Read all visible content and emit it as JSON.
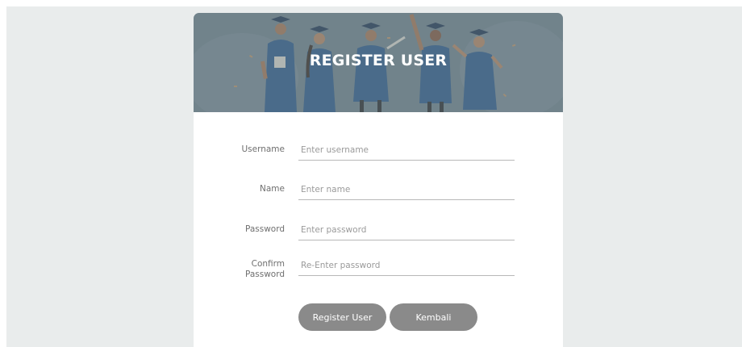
{
  "banner": {
    "title": "REGISTER USER"
  },
  "form": {
    "username": {
      "label": "Username",
      "placeholder": "Enter username"
    },
    "name": {
      "label": "Name",
      "placeholder": "Enter name"
    },
    "password": {
      "label": "Password",
      "placeholder": "Enter password"
    },
    "confirm_password": {
      "label_line1": "Confirm",
      "label_line2": "Password",
      "placeholder": "Re-Enter password"
    }
  },
  "buttons": {
    "register_label": "Register User",
    "back_label": "Kembali"
  },
  "colors": {
    "page_background": "#e9ecec",
    "banner_overlay": "#75878f",
    "gown_blue": "#2f5c8c",
    "button_gray": "#8a8a8a",
    "banner_text": "#ffffff"
  }
}
